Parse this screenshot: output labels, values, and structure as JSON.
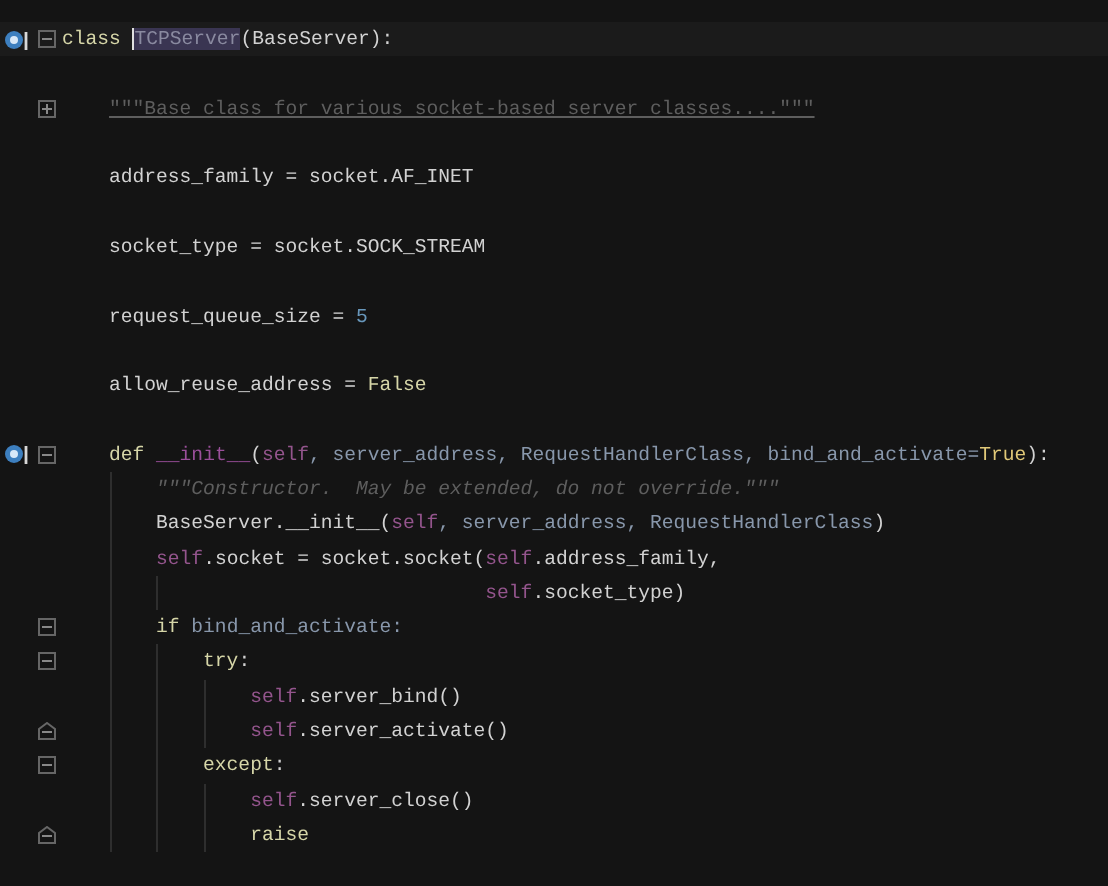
{
  "editor": {
    "lines": [
      {
        "kind": "code",
        "marker": true,
        "collapsed": false,
        "current": true,
        "tokens": [
          {
            "text": "class ",
            "kind": "keyword"
          },
          {
            "text": "TCPServer",
            "kind": "highlight"
          },
          {
            "text": "(BaseServer):",
            "kind": "plain"
          }
        ],
        "children": [
          {
            "kind": "blank"
          },
          {
            "kind": "code",
            "collapsed": true,
            "tokens": [
              {
                "text": "\"\"\"Base class for various socket-based server classes....\"\"\"",
                "kind": "doc"
              }
            ]
          },
          {
            "kind": "blank"
          },
          {
            "kind": "code",
            "tokens": [
              {
                "text": "address_family = socket.AF_INET",
                "kind": "plain"
              }
            ]
          },
          {
            "kind": "blank"
          },
          {
            "kind": "code",
            "tokens": [
              {
                "text": "socket_type = socket.SOCK_STREAM",
                "kind": "plain"
              }
            ]
          },
          {
            "kind": "blank"
          },
          {
            "kind": "code",
            "tokens": [
              {
                "text": "request_queue_size = ",
                "kind": "plain"
              },
              {
                "text": "5",
                "kind": "number"
              }
            ]
          },
          {
            "kind": "blank"
          },
          {
            "kind": "code",
            "tokens": [
              {
                "text": "allow_reuse_address = ",
                "kind": "plain"
              },
              {
                "text": "False",
                "kind": "keyword"
              }
            ]
          },
          {
            "kind": "blank"
          },
          {
            "kind": "code",
            "marker": true,
            "collapsed": false,
            "tokens": [
              {
                "text": "def ",
                "kind": "keyword"
              },
              {
                "text": "__init__",
                "kind": "magic"
              },
              {
                "text": "(",
                "kind": "plain"
              },
              {
                "text": "self",
                "kind": "self"
              },
              {
                "text": ", server_address, RequestHandlerClass, bind_and_activate=",
                "kind": "param"
              },
              {
                "text": "True",
                "kind": "const"
              },
              {
                "text": "):",
                "kind": "plain"
              }
            ],
            "children": [
              {
                "kind": "code",
                "tokens": [
                  {
                    "text": "\"\"\"Constructor.  May be extended, do not override.\"\"\"",
                    "kind": "docitalic"
                  }
                ]
              },
              {
                "kind": "code",
                "tokens": [
                  {
                    "text": "BaseServer.__init__(",
                    "kind": "plain"
                  },
                  {
                    "text": "self",
                    "kind": "self"
                  },
                  {
                    "text": ", server_address, RequestHandlerClass",
                    "kind": "param"
                  },
                  {
                    "text": ")",
                    "kind": "plain"
                  }
                ]
              },
              {
                "kind": "code",
                "tokens": [
                  {
                    "text": "self",
                    "kind": "self"
                  },
                  {
                    "text": ".socket = socket.socket(",
                    "kind": "plain"
                  },
                  {
                    "text": "self",
                    "kind": "self"
                  },
                  {
                    "text": ".address_family,",
                    "kind": "plain"
                  }
                ],
                "children": [
                  {
                    "kind": "continuation",
                    "tokens": [
                      {
                        "text": "self",
                        "kind": "self"
                      },
                      {
                        "text": ".socket_type)",
                        "kind": "plain"
                      }
                    ]
                  }
                ]
              },
              {
                "kind": "code",
                "collapsed": false,
                "tokens": [
                  {
                    "text": "if",
                    "kind": "keyword"
                  },
                  {
                    "text": " bind_and_activate:",
                    "kind": "param"
                  }
                ],
                "children": [
                  {
                    "kind": "code",
                    "collapsed": false,
                    "tokens": [
                      {
                        "text": "try",
                        "kind": "keyword"
                      },
                      {
                        "text": ":",
                        "kind": "plain"
                      }
                    ],
                    "children": [
                      {
                        "kind": "code",
                        "tokens": [
                          {
                            "text": "self",
                            "kind": "self"
                          },
                          {
                            "text": ".server_bind()",
                            "kind": "plain"
                          }
                        ]
                      },
                      {
                        "kind": "code",
                        "fold_end": true,
                        "tokens": [
                          {
                            "text": "self",
                            "kind": "self"
                          },
                          {
                            "text": ".server_activate()",
                            "kind": "plain"
                          }
                        ]
                      }
                    ]
                  },
                  {
                    "kind": "code",
                    "collapsed": false,
                    "tokens": [
                      {
                        "text": "except",
                        "kind": "keyword"
                      },
                      {
                        "text": ":",
                        "kind": "plain"
                      }
                    ],
                    "children": [
                      {
                        "kind": "code",
                        "tokens": [
                          {
                            "text": "self",
                            "kind": "self"
                          },
                          {
                            "text": ".server_close()",
                            "kind": "plain"
                          }
                        ]
                      },
                      {
                        "kind": "code",
                        "fold_end": true,
                        "tokens": [
                          {
                            "text": "raise",
                            "kind": "keyword"
                          }
                        ]
                      }
                    ]
                  }
                ]
              }
            ]
          }
        ]
      }
    ]
  }
}
